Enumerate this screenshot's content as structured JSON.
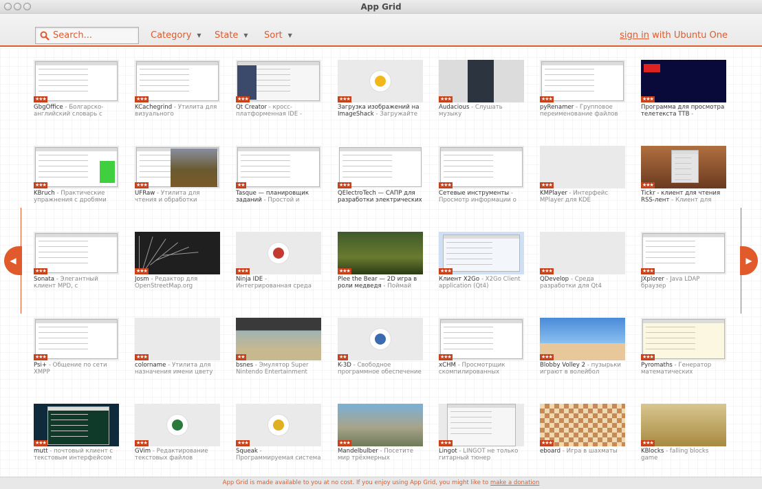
{
  "window": {
    "title": "App Grid"
  },
  "header": {
    "search_placeholder": "Search...",
    "category_label": "Category",
    "state_label": "State",
    "sort_label": "Sort",
    "signin_link": "sign in",
    "signin_suffix": " with Ubuntu One"
  },
  "colors": {
    "accent": "#e05a2b",
    "stars": "#c7411b"
  },
  "apps": [
    {
      "name": "GbgOffice",
      "desc": " - Болгарско-английский словарь с инте...",
      "stars": "★★★"
    },
    {
      "name": "KCachegrind",
      "desc": " - Утилита для визуального профилирован...",
      "stars": "★★★"
    },
    {
      "name": "Qt Creator",
      "desc": " - кросс-платформенная IDE - легка...",
      "stars": "★★★"
    },
    {
      "name": "Загрузка изображений на ImageShack",
      "desc": " - Загружайте св...",
      "stars": "★★★"
    },
    {
      "name": "Audacious",
      "desc": " - Слушать музыку",
      "stars": "★★★"
    },
    {
      "name": "pyRenamer",
      "desc": " - Групповое переименование файлов",
      "stars": "★★★"
    },
    {
      "name": "Программа для просмотра телетекста TTB",
      "desc": " - Программ...",
      "stars": "★★★"
    },
    {
      "name": "KBruch",
      "desc": " - Практические упражнения с дробями",
      "stars": "★★★"
    },
    {
      "name": "UFRaw",
      "desc": " - Утилита для чтения и обработки изображений, по...",
      "stars": "★★★"
    },
    {
      "name": "Tasque — планировщик заданий",
      "desc": " - Простой и быстр...",
      "stars": "★★"
    },
    {
      "name": "QElectroTech — САПР для разработки электрических (...",
      "desc": "",
      "stars": "★★★"
    },
    {
      "name": "Сетевые инструменты",
      "desc": " - Просмотр информации о се...",
      "stars": "★★★"
    },
    {
      "name": "KMPlayer",
      "desc": " - Интерфейс MPlayer для KDE",
      "stars": "★★★"
    },
    {
      "name": "Tickr - клиент для чтения RSS-лент",
      "desc": " - Клиент для чтен...",
      "stars": "★★★"
    },
    {
      "name": "Sonata",
      "desc": " - Элегантный клиент MPD, с использованием GTK+",
      "stars": "★★★"
    },
    {
      "name": "Josm",
      "desc": " - Редактор для OpenStreetMap.org",
      "stars": "★★★"
    },
    {
      "name": "Ninja IDE",
      "desc": " - Интегрированная среда разработки на языке ...",
      "stars": "★★★"
    },
    {
      "name": "Plee the Bear — 2D игра в роли медведя",
      "desc": " - Поймай сво...",
      "stars": "★★★"
    },
    {
      "name": "Клиент X2Go",
      "desc": " - X2Go Client application (Qt4)",
      "stars": "★★★"
    },
    {
      "name": "QDevelop",
      "desc": " - Среда разработки для Qt4",
      "stars": "★★★"
    },
    {
      "name": "JXplorer",
      "desc": " - Java LDAP браузер",
      "stars": "★★★"
    },
    {
      "name": "Psi+",
      "desc": " - Общение по сети XMPP",
      "stars": "★★★"
    },
    {
      "name": "colorname",
      "desc": " - Утилита для назначения имени цвету",
      "stars": "★★★"
    },
    {
      "name": "bsnes",
      "desc": " - Эмулятор Super Nintendo Entertainment System",
      "stars": "★★"
    },
    {
      "name": "K-3D",
      "desc": " - Свободное программное обеспечение ...",
      "stars": "★★"
    },
    {
      "name": "xCHM",
      "desc": " - Просмотрщик скомпилированных файлов...",
      "stars": "★★★"
    },
    {
      "name": "Blobby Volley 2",
      "desc": " - пузырьки играют в волейбол",
      "stars": "★★★"
    },
    {
      "name": "Pyromaths",
      "desc": " - Генератор математических упражнен...",
      "stars": "★★★"
    },
    {
      "name": "mutt",
      "desc": " - почтовый клиент с текстовым интерфейсом",
      "stars": "★★★"
    },
    {
      "name": "GVim",
      "desc": " - Редактирование текстовых файлов",
      "stars": "★★★"
    },
    {
      "name": "Squeak",
      "desc": " - Программируемая система и утилита для разр...",
      "stars": "★★★"
    },
    {
      "name": "Mandelbulber",
      "desc": " - Посетите мир трёхмерных фракталов",
      "stars": "★★★"
    },
    {
      "name": "Lingot",
      "desc": " - LINGOT не только гитарный тюнер",
      "stars": "★★★"
    },
    {
      "name": "eboard",
      "desc": " - Игра в шахматы",
      "stars": "★★★"
    },
    {
      "name": "KBlocks",
      "desc": " - falling blocks game",
      "stars": "★★★"
    }
  ],
  "thumb_styles": [
    "ui",
    "ui",
    "ide",
    "emblem-yellow",
    "dark-ui",
    "ui",
    "teletext",
    "ui-green",
    "photo",
    "ui",
    "diagram",
    "ui",
    "blank",
    "sunset",
    "ui",
    "map",
    "emblem-dark",
    "game",
    "ui-blue",
    "blank",
    "ui",
    "ui",
    "blank",
    "game-sea",
    "emblem-blue",
    "ui",
    "beach",
    "ui-yellow",
    "terminal",
    "emblem-green",
    "emblem-yellow2",
    "fractal",
    "tuner",
    "chess",
    "kblocks"
  ],
  "nav": {
    "prev": "◀",
    "next": "▶"
  },
  "footer": {
    "text": "App Grid is made available to you at no cost. If you enjoy using App Grid, you might like to ",
    "link": "make a donation"
  }
}
